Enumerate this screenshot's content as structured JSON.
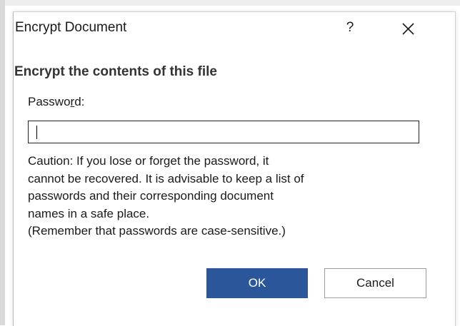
{
  "dialog": {
    "title": "Encrypt Document",
    "help_label": "?",
    "close_icon": "close-icon",
    "heading": "Encrypt the contents of this file",
    "password_label_before": "Passwo",
    "password_label_accel": "r",
    "password_label_after": "d:",
    "password_value": "",
    "caution_text": "Caution: If you lose or forget the password, it\ncannot be recovered. It is advisable to keep a list of\npasswords and their corresponding document\nnames in a safe place.\n(Remember that passwords are case-sensitive.)",
    "ok_label": "OK",
    "cancel_label": "Cancel"
  },
  "colors": {
    "ok_background": "#2b579a",
    "text": "#1a1a1a"
  }
}
